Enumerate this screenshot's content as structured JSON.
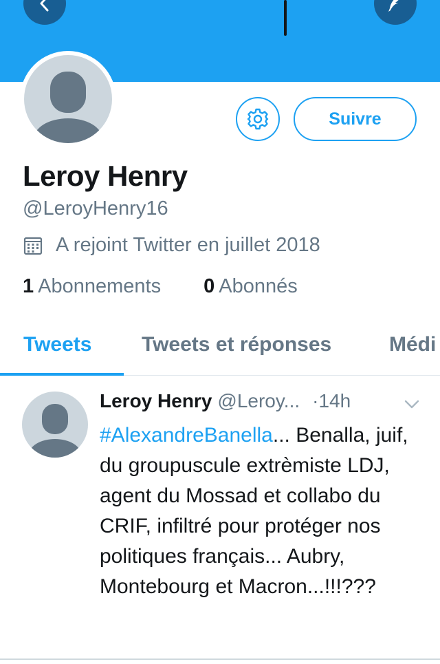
{
  "banner": {
    "color": "#1da1f2",
    "back_icon": "chevron-left-icon",
    "compose_icon": "feather-icon"
  },
  "profile": {
    "name": "Leroy Henry",
    "handle": "@LeroyHenry16",
    "joined": "A rejoint Twitter en juillet 2018",
    "following_count": "1",
    "following_label": "Abonnements",
    "followers_count": "0",
    "followers_label": "Abonnés",
    "follow_button": "Suivre",
    "settings_icon": "gear-icon",
    "calendar_icon": "calendar-icon"
  },
  "tabs": [
    {
      "label": "Tweets",
      "active": true
    },
    {
      "label": "Tweets et réponses",
      "active": false
    },
    {
      "label": "Médi",
      "active": false
    }
  ],
  "tweet": {
    "author_name": "Leroy Henry",
    "author_handle": "@Leroy...",
    "time": "·14h",
    "hashtag": "#AlexandreBanella",
    "text": "... Benalla, juif, du groupuscule extrèmiste LDJ, agent du Mossad et collabo du CRIF, infiltré pour protéger nos politiques français... Aubry, Montebourg et Macron...!!!???",
    "menu_icon": "chevron-down-icon"
  },
  "colors": {
    "accent": "#1da1f2",
    "secondary_text": "#657786",
    "avatar_placeholder": "#ccd6dd"
  }
}
